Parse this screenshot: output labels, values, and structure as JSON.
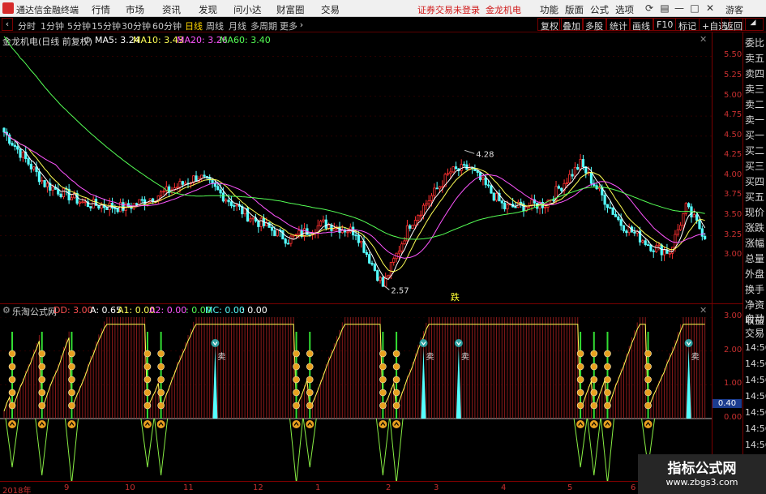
{
  "app": {
    "title": "通达信金融终端",
    "warning": "证券交易未登录",
    "stock": "金龙机电",
    "user": "游客"
  },
  "menu": [
    "行情",
    "市场",
    "资讯",
    "发现",
    "问小达",
    "财富圈",
    "交易"
  ],
  "right_menu": [
    "功能",
    "版面",
    "公式",
    "选项"
  ],
  "window_icons": [
    "refresh-icon",
    "settings-icon",
    "minimize-icon",
    "maximize-icon",
    "close-icon"
  ],
  "timeframes": [
    "分时",
    "1分钟",
    "5分钟",
    "15分钟",
    "30分钟",
    "60分钟",
    "日线",
    "周线",
    "月线",
    "多周期",
    "更多"
  ],
  "active_timeframe": "日线",
  "tool_buttons": [
    "复权",
    "叠加",
    "多股",
    "统计",
    "画线",
    "F10",
    "标记",
    "+自选",
    "返回"
  ],
  "ma_info": {
    "name": "金龙机电(日线 前复权)",
    "items": [
      {
        "label": "MA5: 3.24",
        "color": "#ffffff"
      },
      {
        "label": "MA10: 3.43",
        "color": "#ffff55"
      },
      {
        "label": "MA20: 3.26",
        "color": "#ff55ff"
      },
      {
        "label": "MA60: 3.40",
        "color": "#55ff55"
      }
    ]
  },
  "indicator_info": {
    "name": "乐淘公式网",
    "items": [
      {
        "label": "DD: 3.00",
        "color": "#ff5050"
      },
      {
        "label": "A: 0.65",
        "color": "#ffffff"
      },
      {
        "label": "A1: 0.00",
        "color": "#ffff55"
      },
      {
        "label": "A2: 0.00",
        "color": "#ff55ff"
      },
      {
        "label": ": 0.00",
        "color": "#55ff55"
      },
      {
        "label": "MC: 0.00",
        "color": "#55ffff"
      },
      {
        "label": ": 0.00",
        "color": "#ffffff"
      }
    ]
  },
  "annotations": {
    "high": "4.28",
    "low": "2.57",
    "down": "跌",
    "sell": "卖"
  },
  "price_axis": [
    "5.50",
    "5.25",
    "5.00",
    "4.75",
    "4.50",
    "4.25",
    "4.00",
    "3.75",
    "3.50",
    "3.25",
    "3.00"
  ],
  "indicator_axis": [
    "3.00",
    "2.00",
    "1.00",
    "0.40",
    "0.00"
  ],
  "indicator_current": "0.40",
  "date_axis": [
    "2018年",
    "9",
    "10",
    "11",
    "12",
    "1",
    "2",
    "3",
    "4",
    "5",
    "6"
  ],
  "right_panel": [
    "委比",
    "卖五",
    "卖四",
    "卖三",
    "卖二",
    "卖一",
    "买一",
    "买二",
    "买三",
    "买四",
    "买五",
    "现价",
    "涨跌",
    "涨幅",
    "总量",
    "外盘",
    "换手",
    "净资",
    "收益",
    "自动",
    "交易"
  ],
  "right_times": [
    "14:56",
    "14:56",
    "14:56",
    "14:56",
    "14:56",
    "14:56",
    "14:56",
    "14:56"
  ],
  "watermark": {
    "main": "指标公式网",
    "url": "www.zbgs3.com"
  },
  "colors": {
    "up": "#ff3030",
    "down": "#55ffff",
    "ma5": "#ffffff",
    "ma10": "#ffff55",
    "ma20": "#ff55ff",
    "ma60": "#55ff55",
    "signal_buy": "#33dd33",
    "signal_sell": "#55ffff",
    "coin": "#e8a020"
  },
  "chart_data": {
    "type": "candlestick",
    "ylim": [
      2.4,
      5.8
    ],
    "key_points": [
      {
        "x": 0,
        "y": 4.55
      },
      {
        "x": 15,
        "y": 3.9
      },
      {
        "x": 30,
        "y": 3.65
      },
      {
        "x": 45,
        "y": 3.6
      },
      {
        "x": 60,
        "y": 3.8
      },
      {
        "x": 72,
        "y": 4.0
      },
      {
        "x": 90,
        "y": 3.5
      },
      {
        "x": 105,
        "y": 3.2
      },
      {
        "x": 118,
        "y": 3.4
      },
      {
        "x": 130,
        "y": 3.3
      },
      {
        "x": 140,
        "y": 2.62
      },
      {
        "x": 150,
        "y": 3.4
      },
      {
        "x": 165,
        "y": 4.05
      },
      {
        "x": 172,
        "y": 4.1
      },
      {
        "x": 185,
        "y": 3.6
      },
      {
        "x": 200,
        "y": 3.65
      },
      {
        "x": 213,
        "y": 4.15
      },
      {
        "x": 228,
        "y": 3.4
      },
      {
        "x": 240,
        "y": 3.1
      },
      {
        "x": 246,
        "y": 3.05
      },
      {
        "x": 252,
        "y": 3.6
      },
      {
        "x": 259,
        "y": 3.25
      }
    ],
    "signals": {
      "buy": [
        3,
        14,
        25,
        53,
        58,
        108,
        113,
        140,
        145,
        213,
        218,
        223,
        238
      ],
      "sell": [
        78,
        155,
        168,
        253
      ]
    }
  }
}
